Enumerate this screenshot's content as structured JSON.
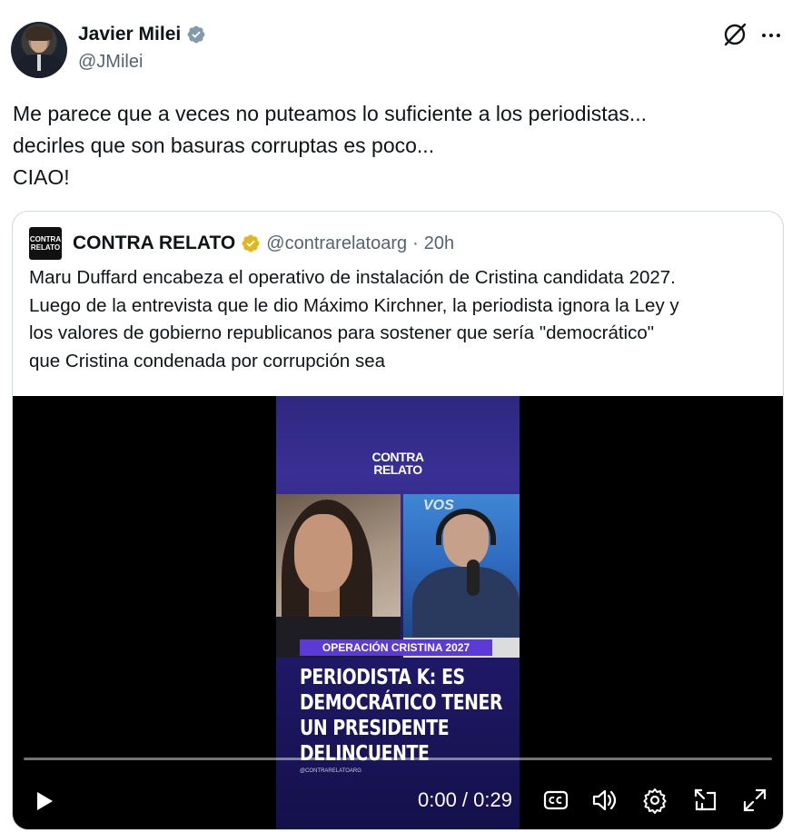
{
  "author": {
    "name": "Javier Milei",
    "handle": "@JMilei",
    "verified_color": "#829aab"
  },
  "tweet": {
    "lines": [
      "Me parece que a veces no puteamos lo suficiente a los periodistas...",
      "decirles que son basuras corruptas es poco...",
      "CIAO!"
    ]
  },
  "quote": {
    "avatar_lines": [
      "CONTRA",
      "RELATO"
    ],
    "name": "CONTRA RELATO",
    "handle": "@contrarelatoarg",
    "separator": "·",
    "time": "20h",
    "badge_color": "#e2b719",
    "lines": [
      "Maru Duffard encabeza el operativo de instalación de Cristina candidata 2027.",
      "Luego de la entrevista que le dio Máximo Kirchner, la periodista ignora la Ley y",
      "los valores de gobierno republicanos para sostener que sería \"democrático\"",
      "que Cristina condenada por corrupción sea"
    ]
  },
  "video": {
    "brand_lines": [
      "CONTRA",
      "RELATO"
    ],
    "studio_logo": "VOS",
    "tag": "OPERACIÓN CRISTINA 2027",
    "headline": [
      "PERIODISTA K: ES",
      "DEMOCRÁTICO TENER",
      "UN PRESIDENTE",
      "DELINCUENTE"
    ],
    "social_handle": "@CONTRARELATOARG",
    "current_time": "0:00",
    "duration": "0:29",
    "time_display": "0:00 / 0:29",
    "progress": 0
  },
  "icons": {
    "grok": "grok-icon",
    "more": "more-icon",
    "play": "play-icon",
    "captions": "captions-icon",
    "volume": "volume-icon",
    "settings": "settings-icon",
    "pip": "picture-in-picture-icon",
    "fullscreen": "fullscreen-icon"
  }
}
